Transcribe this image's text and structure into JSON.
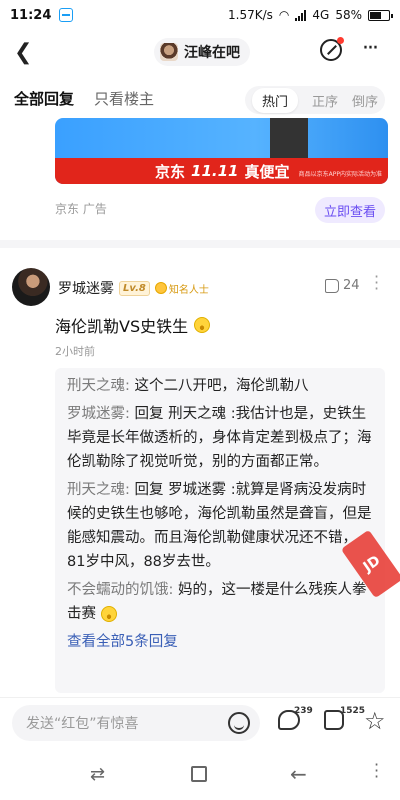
{
  "status_bar": {
    "time": "11:24",
    "speed": "1.57K/s",
    "network": "4G",
    "battery": "58%"
  },
  "nav": {
    "title": "汪峰在吧"
  },
  "tabs": {
    "all": "全部回复",
    "host_only": "只看楼主",
    "sort_hot": "热门",
    "sort_asc": "正序",
    "sort_desc": "倒序"
  },
  "ad": {
    "banner_brand": "京东",
    "banner_event": "11.11",
    "banner_slogan": "真便宜",
    "banner_fine": "商品以京东APP内实际活动为准",
    "source": "京东  广告",
    "cta": "立即查看"
  },
  "post": {
    "author": "罗城迷雾",
    "level": "Lv.8",
    "badge": "知名人士",
    "likes": "24",
    "text": "海伦凯勒VS史铁生",
    "time": "2小时前"
  },
  "replies": [
    {
      "who": "刑天之魂:",
      "to": "",
      "text": " 这个二八开吧，海伦凯勒八"
    },
    {
      "who": "罗城迷雾:",
      "to": " 回复 刑天之魂",
      "text": " :我估计也是，史铁生毕竟是长年做透析的，身体肯定差到极点了；海伦凯勒除了视觉听觉，别的方面都正常。"
    },
    {
      "who": "刑天之魂:",
      "to": " 回复 罗城迷雾",
      "text": " :就算是肾病没发病时候的史铁生也够呛，海伦凯勒虽然是聋盲，但是能感知震动。而且海伦凯勒健康状况还不错，81岁中风，88岁去世。"
    },
    {
      "who": "不会蠕动的饥饿:",
      "to": "",
      "text": " 妈的，这一楼是什么残疾人拳击赛"
    }
  ],
  "view_all": "查看全部5条回复",
  "bottom": {
    "placeholder": "发送“红包”有惊喜",
    "comment_count": "239",
    "like_count": "1525"
  }
}
